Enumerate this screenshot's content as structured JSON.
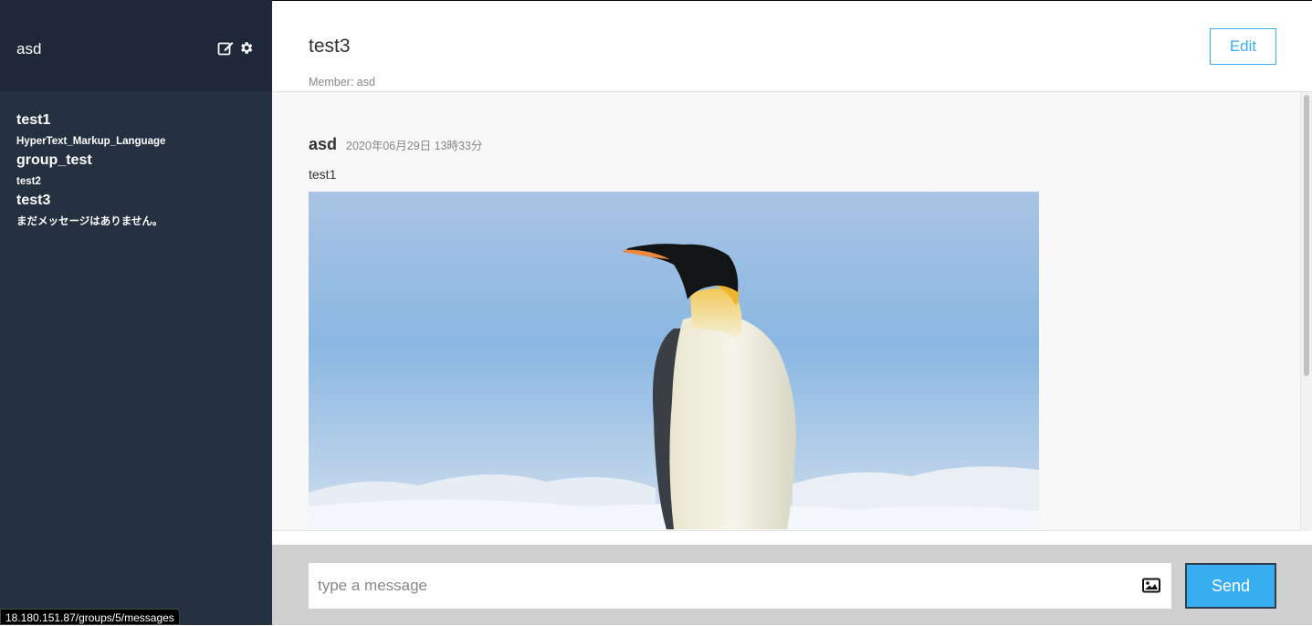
{
  "sidebar": {
    "user_name": "asd",
    "groups": [
      {
        "name": "test1",
        "last_message": "HyperText_Markup_Language"
      },
      {
        "name": "group_test",
        "last_message": "test2"
      },
      {
        "name": "test3",
        "last_message": "まだメッセージはありません。"
      }
    ]
  },
  "main": {
    "group_name": "test3",
    "member_label": "Member: asd",
    "edit_label": "Edit",
    "message": {
      "user": "asd",
      "date": "2020年06月29日 13時33分",
      "text": "test1",
      "image": "penguin-photo"
    }
  },
  "form": {
    "placeholder": "type a message",
    "send_label": "Send"
  },
  "status_bar": {
    "url": "18.180.151.87/groups/5/messages"
  },
  "colors": {
    "sidebar": "#253141",
    "sidebar_header": "#1f2838",
    "accent": "#38aef0"
  }
}
